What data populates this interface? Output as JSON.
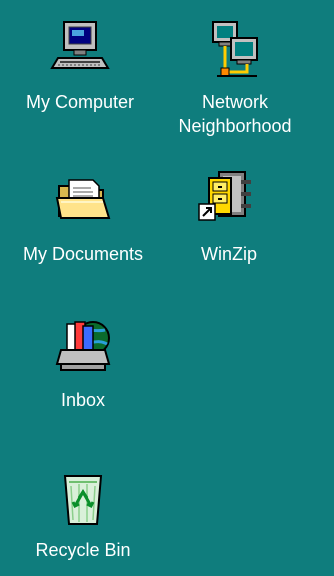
{
  "desktop": {
    "background_color": "#0f7d7d",
    "label_color": "#ffffff",
    "icons": [
      {
        "name": "my-computer",
        "label": "My Computer",
        "icon": "computer-icon"
      },
      {
        "name": "network-neighborhood",
        "label": "Network\nNeighborhood",
        "icon": "network-icon"
      },
      {
        "name": "my-documents",
        "label": "My Documents",
        "icon": "folder-documents-icon"
      },
      {
        "name": "winzip",
        "label": "WinZip",
        "icon": "winzip-icon"
      },
      {
        "name": "inbox",
        "label": "Inbox",
        "icon": "inbox-icon"
      },
      {
        "name": "recycle-bin",
        "label": "Recycle Bin",
        "icon": "recycle-bin-icon"
      }
    ]
  }
}
